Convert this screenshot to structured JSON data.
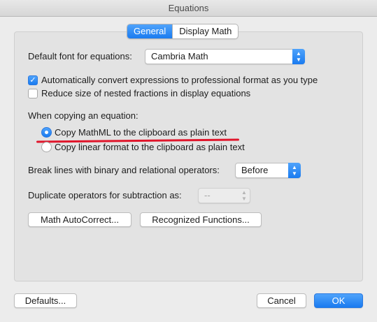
{
  "window": {
    "title": "Equations"
  },
  "tabs": [
    {
      "label": "General",
      "active": true
    },
    {
      "label": "Display Math",
      "active": false
    }
  ],
  "font": {
    "label": "Default font for equations:",
    "value": "Cambria Math"
  },
  "checkboxes": [
    {
      "label": "Automatically convert expressions to professional format as you type",
      "checked": true
    },
    {
      "label": "Reduce size of nested fractions in display equations",
      "checked": false
    }
  ],
  "copying": {
    "label": "When copying an equation:",
    "options": [
      {
        "label": "Copy MathML to the clipboard as plain text",
        "selected": true
      },
      {
        "label": "Copy linear format to the clipboard as plain text",
        "selected": false
      }
    ]
  },
  "break_lines": {
    "label": "Break lines with binary and relational operators:",
    "value": "Before"
  },
  "duplicate": {
    "label": "Duplicate operators for subtraction as:",
    "value": "--"
  },
  "buttons": {
    "autocorrect": "Math AutoCorrect...",
    "functions": "Recognized Functions...",
    "defaults": "Defaults...",
    "cancel": "Cancel",
    "ok": "OK"
  },
  "colors": {
    "accent": "#1a7bf0",
    "annotation": "#e0162b"
  }
}
